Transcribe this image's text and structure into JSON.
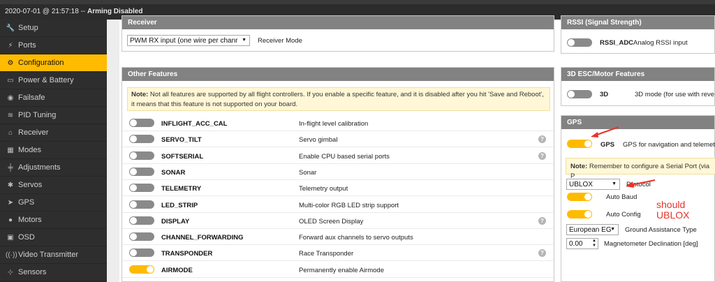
{
  "status": {
    "timestamp": "2020-07-01 @ 21:57:18",
    "separator": " -- ",
    "state": "Arming Disabled"
  },
  "sidebar": {
    "items": [
      {
        "label": "Setup",
        "icon": "wrench-icon",
        "glyph": "🔧"
      },
      {
        "label": "Ports",
        "icon": "plug-icon",
        "glyph": "⚡"
      },
      {
        "label": "Configuration",
        "icon": "gear-icon",
        "glyph": "⚙"
      },
      {
        "label": "Power & Battery",
        "icon": "battery-icon",
        "glyph": "▭"
      },
      {
        "label": "Failsafe",
        "icon": "failsafe-icon",
        "glyph": "◉"
      },
      {
        "label": "PID Tuning",
        "icon": "pid-icon",
        "glyph": "≋"
      },
      {
        "label": "Receiver",
        "icon": "receiver-icon",
        "glyph": "⌂"
      },
      {
        "label": "Modes",
        "icon": "modes-icon",
        "glyph": "▦"
      },
      {
        "label": "Adjustments",
        "icon": "sliders-icon",
        "glyph": "╪"
      },
      {
        "label": "Servos",
        "icon": "servo-icon",
        "glyph": "✱"
      },
      {
        "label": "GPS",
        "icon": "location-icon",
        "glyph": "➤"
      },
      {
        "label": "Motors",
        "icon": "motor-icon",
        "glyph": "●"
      },
      {
        "label": "OSD",
        "icon": "osd-icon",
        "glyph": "▣"
      },
      {
        "label": "Video Transmitter",
        "icon": "antenna-icon",
        "glyph": "((·))"
      },
      {
        "label": "Sensors",
        "icon": "sensors-icon",
        "glyph": "⊹"
      }
    ],
    "active_index": 2
  },
  "receiver": {
    "title": "Receiver",
    "selected": "PWM RX input (one wire per chanr",
    "mode_label": "Receiver Mode"
  },
  "rssi": {
    "title": "RSSI (Signal Strength)",
    "name": "RSSI_ADC",
    "desc": "Analog RSSI input",
    "enabled": false
  },
  "other_features": {
    "title": "Other Features",
    "note_bold": "Note:",
    "note_text": " Not all features are supported by all flight controllers. If you enable a specific feature, and it is disabled after you hit 'Save and Reboot', it means that this feature is not supported on your board.",
    "features": [
      {
        "name": "INFLIGHT_ACC_CAL",
        "desc": "In-flight level calibration",
        "enabled": false,
        "help": false
      },
      {
        "name": "SERVO_TILT",
        "desc": "Servo gimbal",
        "enabled": false,
        "help": true
      },
      {
        "name": "SOFTSERIAL",
        "desc": "Enable CPU based serial ports",
        "enabled": false,
        "help": true
      },
      {
        "name": "SONAR",
        "desc": "Sonar",
        "enabled": false,
        "help": false
      },
      {
        "name": "TELEMETRY",
        "desc": "Telemetry output",
        "enabled": false,
        "help": false
      },
      {
        "name": "LED_STRIP",
        "desc": "Multi-color RGB LED strip support",
        "enabled": false,
        "help": false
      },
      {
        "name": "DISPLAY",
        "desc": "OLED Screen Display",
        "enabled": false,
        "help": true
      },
      {
        "name": "CHANNEL_FORWARDING",
        "desc": "Forward aux channels to servo outputs",
        "enabled": false,
        "help": false
      },
      {
        "name": "TRANSPONDER",
        "desc": "Race Transponder",
        "enabled": false,
        "help": true
      },
      {
        "name": "AIRMODE",
        "desc": "Permanently enable Airmode",
        "enabled": true,
        "help": false
      }
    ]
  },
  "esc3d": {
    "title": "3D ESC/Motor Features",
    "name": "3D",
    "desc": "3D mode (for use with reve",
    "enabled": false
  },
  "gps": {
    "title": "GPS",
    "name": "GPS",
    "desc": "GPS for navigation and telemet",
    "enabled": true,
    "note_bold": "Note:",
    "note_text": " Remember to configure a Serial Port (via P",
    "protocol_value": "UBLOX",
    "protocol_label": "Protocol",
    "auto_baud_label": "Auto Baud",
    "auto_baud_enabled": true,
    "auto_config_label": "Auto Config",
    "auto_config_enabled": true,
    "assist_value": "European EG",
    "assist_label": "Ground Assistance Type",
    "mag_decl_value": "0.00",
    "mag_decl_label": "Magnetometer Declination [deg]"
  },
  "annotation": {
    "line1": "should",
    "line2": "UBLOX",
    "color": "#e8332a"
  },
  "colors": {
    "accent": "#ffbb00",
    "sidebar": "#2e2e2e",
    "header": "#828282"
  }
}
